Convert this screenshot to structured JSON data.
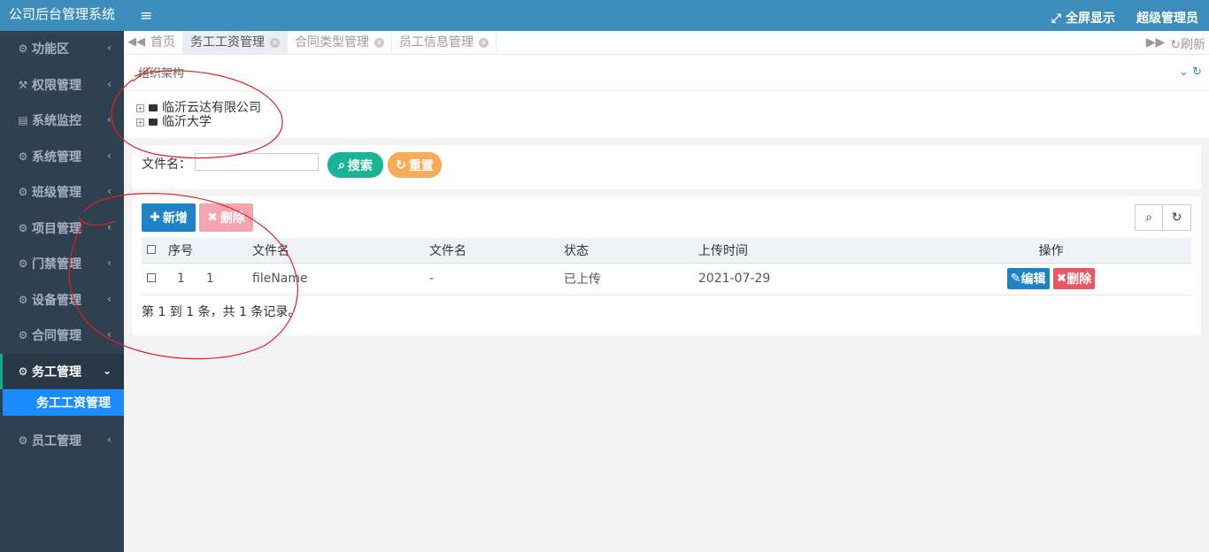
{
  "app": {
    "title": "公司后台管理系统"
  },
  "sidebar": {
    "items": [
      {
        "label": "功能区",
        "icon": "gear-icon",
        "glyph": "⚙"
      },
      {
        "label": "权限管理",
        "icon": "wrench-icon",
        "glyph": "🔧"
      },
      {
        "label": "系统监控",
        "icon": "server-icon",
        "glyph": "▤"
      },
      {
        "label": "系统管理",
        "icon": "gear-icon",
        "glyph": "⚙"
      },
      {
        "label": "班级管理",
        "icon": "gear-icon",
        "glyph": "⚙"
      },
      {
        "label": "项目管理",
        "icon": "gear-icon",
        "glyph": "⚙"
      },
      {
        "label": "门禁管理",
        "icon": "gear-icon",
        "glyph": "⚙"
      },
      {
        "label": "设备管理",
        "icon": "gear-icon",
        "glyph": "⚙"
      },
      {
        "label": "合同管理",
        "icon": "gear-icon",
        "glyph": "⚙"
      },
      {
        "label": "务工管理",
        "icon": "gear-icon",
        "glyph": "⚙"
      },
      {
        "label": "员工管理",
        "icon": "gear-icon",
        "glyph": "⚙"
      }
    ],
    "active_sub": "务工工资管理"
  },
  "topbar": {
    "fullscreen": "全屏显示",
    "user": "超级管理员"
  },
  "tabs": [
    {
      "label": "首页"
    },
    {
      "label": "务工工资管理"
    },
    {
      "label": "合同类型管理"
    },
    {
      "label": "员工信息管理"
    }
  ],
  "tabbar": {
    "refresh": "刷新"
  },
  "org": {
    "title": "组织架构",
    "nodes": [
      "临沂云达有限公司",
      "临沂大学"
    ]
  },
  "search": {
    "label": "文件名：",
    "value": "",
    "search_btn": "搜索",
    "reset_btn": "重置"
  },
  "toolbar": {
    "add": "新增",
    "delete": "删除"
  },
  "table": {
    "headers": [
      "序号",
      "文件名",
      "文件名",
      "状态",
      "上传时间",
      "操作"
    ],
    "rows": [
      {
        "seq": "1",
        "id": "1",
        "file": "fileName",
        "name": "-",
        "status": "已上传",
        "time": "2021-07-29",
        "edit": "编辑",
        "del": "删除"
      }
    ],
    "pager": "第 1 到 1 条，共 1 条记录。"
  },
  "colors": {
    "sidebar": "#2f4050",
    "topbar": "#3c8dbc",
    "primary": "#1c84c6",
    "danger": "#ed5565",
    "success": "#1ab394",
    "warning": "#f8ac59",
    "annotation": "#e02020"
  }
}
